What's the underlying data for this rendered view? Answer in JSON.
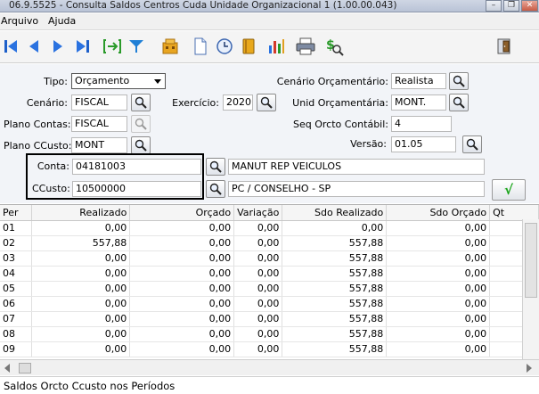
{
  "window": {
    "title": "06.9.5525 - Consulta Saldos Centros Cuda Unidade Organizacional 1 (1.00.00.043)",
    "minimize": "–",
    "restore": "❐",
    "close": "✕"
  },
  "menu": [
    "Arquivo",
    "Ajuda"
  ],
  "toolbar": {
    "icons": [
      "first-record-icon",
      "previous-record-icon",
      "next-record-icon",
      "last-record-icon",
      "goto-icon",
      "filter-icon",
      "organization-icon",
      "new-document-icon",
      "clock-icon",
      "book-icon",
      "chart-icon",
      "print-icon",
      "money-search-icon",
      "exit-icon"
    ]
  },
  "form": {
    "tipo": {
      "label": "Tipo:",
      "value": "Orçamento"
    },
    "cenario": {
      "label": "Cenário:",
      "value": "FISCAL"
    },
    "plano_contas": {
      "label": "Plano Contas:",
      "value": "FISCAL"
    },
    "plano_ccusto": {
      "label": "Plano CCusto:",
      "value": "MONT"
    },
    "exercicio": {
      "label": "Exercício:",
      "value": "2020"
    },
    "cenario_orc": {
      "label": "Cenário Orçamentário:",
      "value": "Realista"
    },
    "unid_orc": {
      "label": "Unid Orçamentária:",
      "value": "MONT."
    },
    "seq_orcto": {
      "label": "Seq Orcto Contábil:",
      "value": "4"
    },
    "versao": {
      "label": "Versão:",
      "value": "01.05"
    },
    "conta": {
      "label": "Conta:",
      "value": "04181003",
      "description": "MANUT REP VEICULOS"
    },
    "ccusto": {
      "label": "CCusto:",
      "value": "10500000",
      "description": "PC / CONSELHO - SP"
    },
    "ok_label": "√"
  },
  "grid": {
    "columns": [
      "Per",
      "Realizado",
      "Orçado",
      "Variação",
      "Sdo Realizado",
      "Sdo Orçado",
      "Qt"
    ],
    "rows": [
      [
        "01",
        "0,00",
        "0,00",
        "0,00",
        "0,00",
        "0,00",
        ""
      ],
      [
        "02",
        "557,88",
        "0,00",
        "0,00",
        "557,88",
        "0,00",
        ""
      ],
      [
        "03",
        "0,00",
        "0,00",
        "0,00",
        "557,88",
        "0,00",
        ""
      ],
      [
        "04",
        "0,00",
        "0,00",
        "0,00",
        "557,88",
        "0,00",
        ""
      ],
      [
        "05",
        "0,00",
        "0,00",
        "0,00",
        "557,88",
        "0,00",
        ""
      ],
      [
        "06",
        "0,00",
        "0,00",
        "0,00",
        "557,88",
        "0,00",
        ""
      ],
      [
        "07",
        "0,00",
        "0,00",
        "0,00",
        "557,88",
        "0,00",
        ""
      ],
      [
        "08",
        "0,00",
        "0,00",
        "0,00",
        "557,88",
        "0,00",
        ""
      ],
      [
        "09",
        "0,00",
        "0,00",
        "0,00",
        "557,88",
        "0,00",
        ""
      ]
    ]
  },
  "status": "Saldos Orcto Ccusto nos Períodos"
}
